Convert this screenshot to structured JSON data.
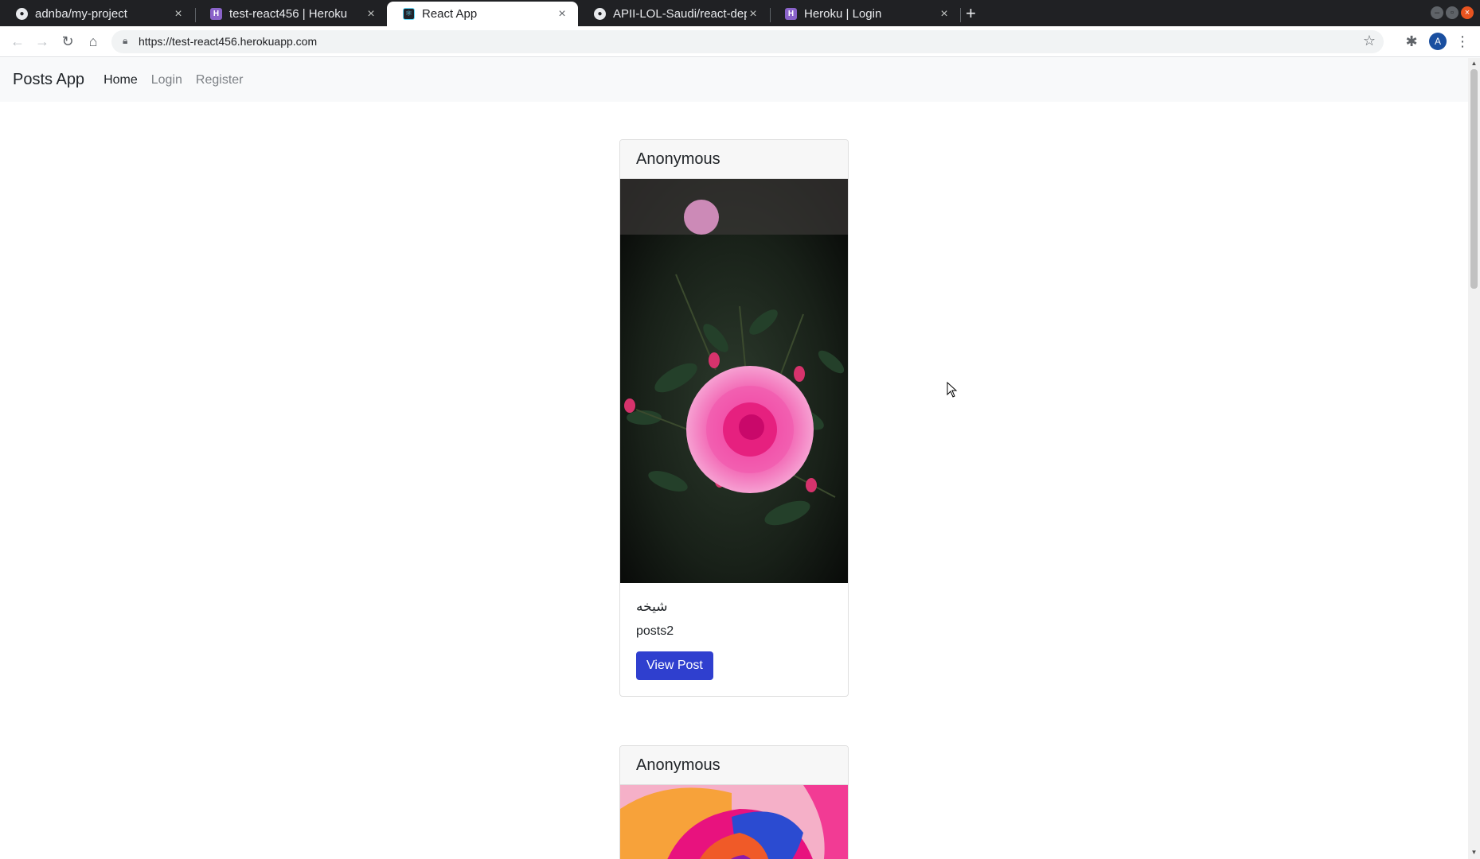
{
  "browser": {
    "tabs": [
      {
        "title": "adnba/my-project",
        "icon": "github-icon"
      },
      {
        "title": "test-react456 | Heroku",
        "icon": "heroku-icon"
      },
      {
        "title": "React App",
        "icon": "react-icon",
        "active": true
      },
      {
        "title": "APII-LOL-Saudi/react-depl",
        "icon": "github-icon"
      },
      {
        "title": "Heroku | Login",
        "icon": "heroku-icon"
      }
    ],
    "url": "https://test-react456.herokuapp.com",
    "profile_initial": "A"
  },
  "navbar": {
    "brand": "Posts App",
    "links": [
      "Home",
      "Login",
      "Register"
    ]
  },
  "posts": [
    {
      "author": "Anonymous",
      "image": "pink-rose-photo",
      "title": "شيخه",
      "text": "posts2",
      "button": "View Post"
    },
    {
      "author": "Anonymous",
      "image": "rainbow-rose-photo"
    }
  ],
  "colors": {
    "button": "#2f3fcf",
    "navbar_bg": "#f8f9fa",
    "tabstrip_bg": "#202124"
  }
}
